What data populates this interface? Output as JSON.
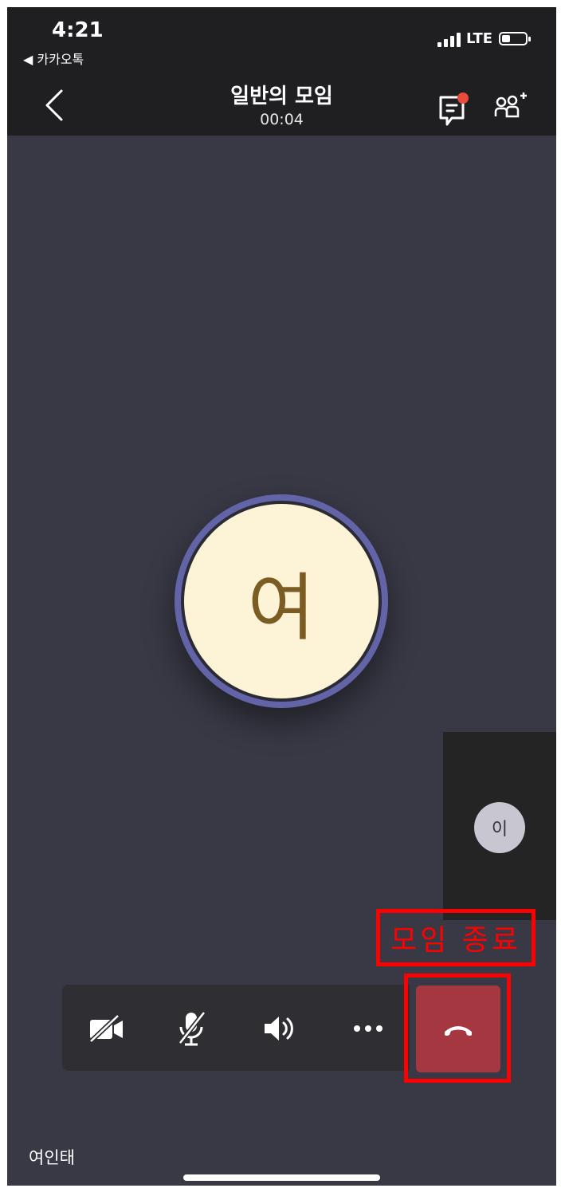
{
  "status_bar": {
    "time": "4:21",
    "back_app": "◀ 카카오톡",
    "network": "LTE"
  },
  "header": {
    "title": "일반의 모임",
    "duration": "00:04",
    "icons": [
      "back-chevron-icon",
      "chat-icon",
      "add-people-icon"
    ],
    "chat_badge_color": "#e74c3c"
  },
  "main_participant": {
    "initial": "여",
    "ring_color": "#6264a7",
    "avatar_bg": "#fdf3d6"
  },
  "side_participant": {
    "initial": "이"
  },
  "annotation": {
    "label": "모임 종료",
    "color": "#ff0000"
  },
  "controls": {
    "icons": [
      "camera-off-icon",
      "mic-off-icon",
      "speaker-icon",
      "more-icon",
      "hang-up-icon"
    ],
    "end_call_color": "#a4373f"
  },
  "footer": {
    "username": "여인태"
  }
}
